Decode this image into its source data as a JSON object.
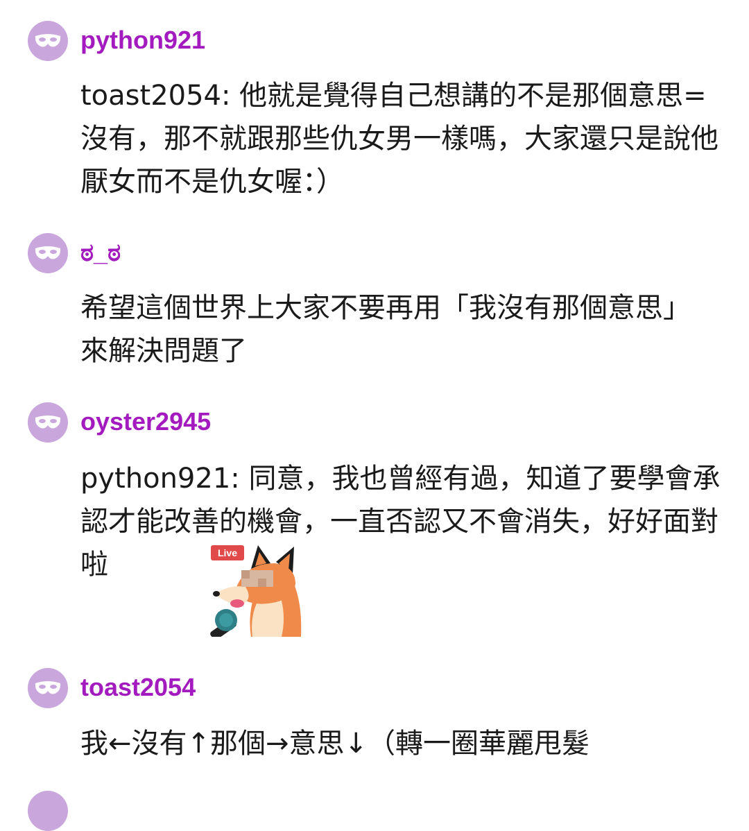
{
  "comments": [
    {
      "username": "python921",
      "text": "toast2054: 他就是覺得自己想講的不是那個意思=沒有，那不就跟那些仇女男一樣嗎，大家還只是說他厭女而不是仇女喔：）"
    },
    {
      "username": "ಠ_ಠ",
      "text": "希望這個世界上大家不要再用「我沒有那個意思」來解決問題了"
    },
    {
      "username": "oyster2945",
      "text": "python921: 同意，我也曾經有過，知道了要學會承認才能改善的機會，一直否認又不會消失，好好面對啦",
      "sticker_badge": "Live"
    },
    {
      "username": "toast2054",
      "text": "我←沒有↑那個→意思↓（轉一圈華麗甩髮"
    }
  ],
  "colors": {
    "username": "#a31bbf",
    "avatar_bg": "#c9a7dd",
    "text": "#1a1a1a"
  },
  "icons": {
    "avatar": "mask-icon"
  }
}
